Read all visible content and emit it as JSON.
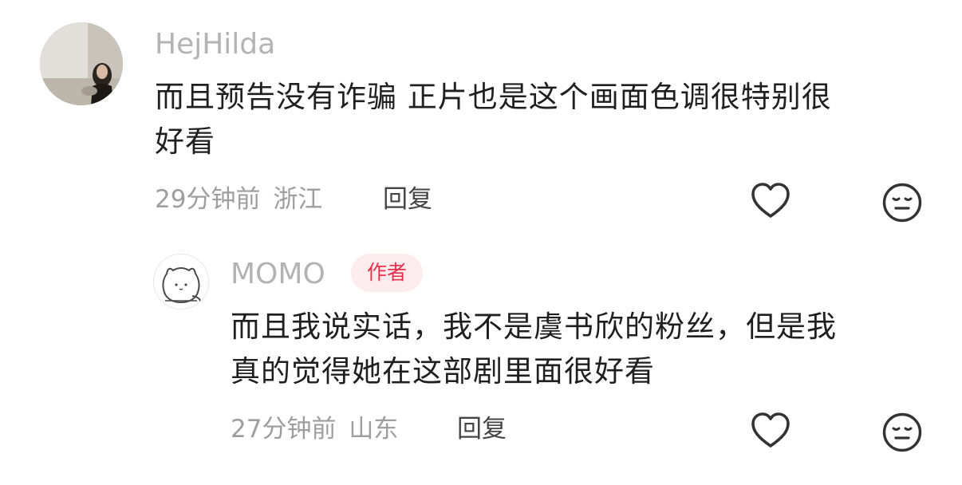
{
  "comments": [
    {
      "username": "HejHilda",
      "text_line1": "而且预告没有诈骗 正片也是这个画面色调很特别很",
      "text_line2": "好看",
      "time": "29分钟前",
      "location": "浙江",
      "reply_label": "回复",
      "avatar_icon": "photo-avatar",
      "like_icon": "heart-icon",
      "dislike_icon": "meh-face-icon"
    }
  ],
  "replies": [
    {
      "username": "MOMO",
      "badge": "作者",
      "text_line1": "而且我说实话，我不是虞书欣的粉丝，但是我",
      "text_line2": "真的觉得她在这部剧里面很好看",
      "time": "27分钟前",
      "location": "山东",
      "reply_label": "回复",
      "avatar_icon": "cat-avatar",
      "like_icon": "heart-icon",
      "dislike_icon": "meh-face-icon"
    }
  ],
  "colors": {
    "username": "#b3b3b3",
    "text": "#1f1f1f",
    "meta": "#9e9e9e",
    "badge_bg": "#fdecee",
    "badge_text": "#e8304a",
    "icon": "#333333"
  }
}
